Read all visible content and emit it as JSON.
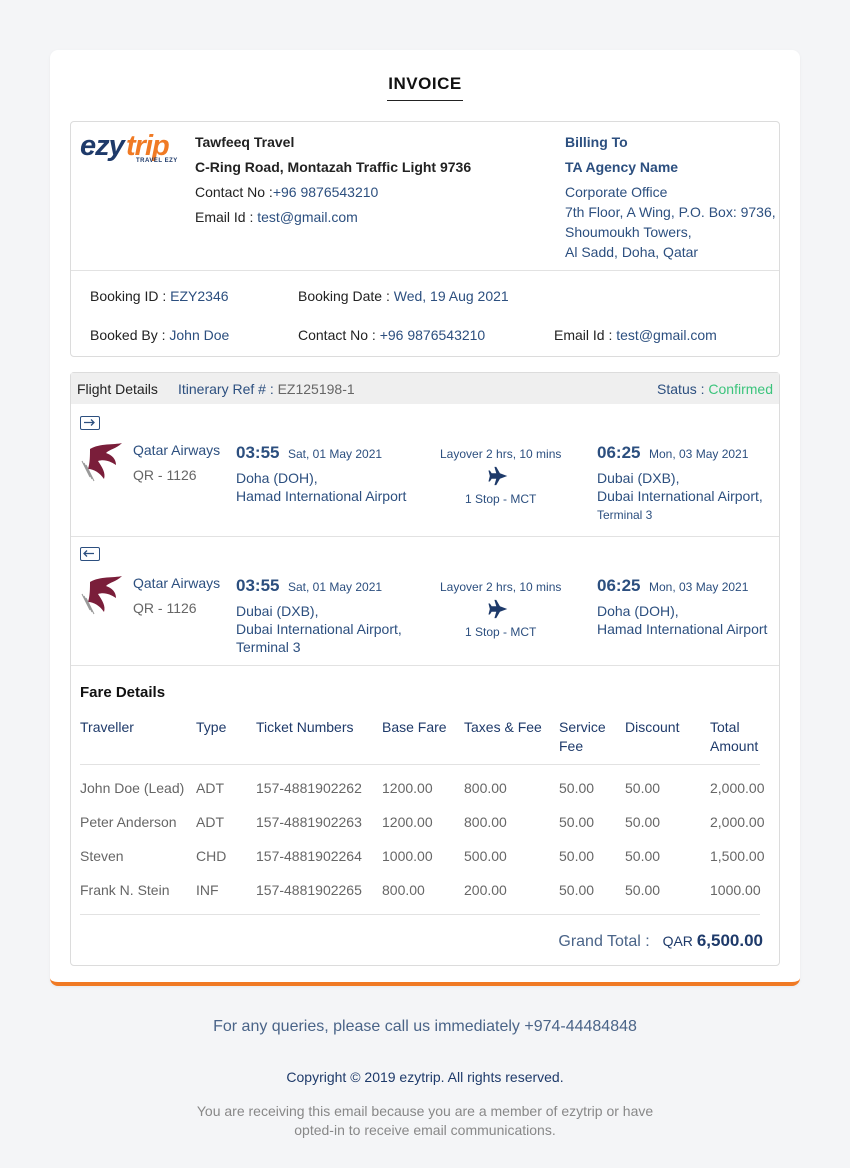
{
  "invoice_title": "INVOICE",
  "brand": {
    "logo_left": "ezy",
    "logo_right": "trip",
    "logo_tag": "TRAVEL EZY"
  },
  "company": {
    "name": "Tawfeeq Travel",
    "address": "C-Ring Road, Montazah Traffic Light 9736",
    "contact_label": "Contact No :",
    "contact_value": "+96 9876543210",
    "email_label": "Email Id :",
    "email_value": "test@gmail.com"
  },
  "billing": {
    "heading": "Billing To",
    "agency": "TA Agency Name",
    "line1": "Corporate Office",
    "line2": "7th Floor, A Wing, P.O. Box: 9736,",
    "line3": "Shoumoukh Towers,",
    "line4": "Al Sadd, Doha, Qatar"
  },
  "booking": {
    "id_label": "Booking ID :",
    "id_value": "EZY2346",
    "date_label": "Booking Date :",
    "date_value": "Wed, 19 Aug 2021",
    "by_label": "Booked By :",
    "by_value": "John Doe",
    "contact_label": "Contact No :",
    "contact_value": "+96 9876543210",
    "email_label": "Email Id :",
    "email_value": "test@gmail.com"
  },
  "flight_details": {
    "heading": "Flight Details",
    "itinerary_label": "Itinerary Ref # :",
    "itinerary_value": "EZ125198-1",
    "status_label": "Status :",
    "status_value": "Confirmed",
    "status_color": "#3cc47c",
    "segments": [
      {
        "airline": "Qatar Airways",
        "flight_no": "QR - 1126",
        "dep_time": "03:55",
        "dep_date": "Sat, 01 May 2021",
        "dep_city": "Doha (DOH),",
        "dep_airport": "Hamad International Airport",
        "dep_terminal": "",
        "layover": "Layover 2 hrs, 10 mins",
        "stops": "1 Stop - MCT",
        "arr_time": "06:25",
        "arr_date": "Mon, 03 May 2021",
        "arr_city": "Dubai (DXB),",
        "arr_airport": "Dubai International Airport,",
        "arr_terminal": "Terminal 3",
        "direction_icon": "departure-icon"
      },
      {
        "airline": "Qatar Airways",
        "flight_no": "QR - 1126",
        "dep_time": "03:55",
        "dep_date": "Sat, 01 May 2021",
        "dep_city": "Dubai (DXB),",
        "dep_airport": "Dubai International Airport,",
        "dep_terminal": "Terminal 3",
        "layover": "Layover 2 hrs, 10 mins",
        "stops": "1 Stop - MCT",
        "arr_time": "06:25",
        "arr_date": "Mon, 03 May 2021",
        "arr_city": "Doha (DOH),",
        "arr_airport": "Hamad International Airport",
        "arr_terminal": "",
        "direction_icon": "return-icon"
      }
    ]
  },
  "fare": {
    "heading": "Fare Details",
    "columns": [
      "Traveller",
      "Type",
      "Ticket Numbers",
      "Base Fare",
      "Taxes & Fee",
      "Service Fee",
      "Discount",
      "Total Amount"
    ],
    "rows": [
      [
        "John Doe (Lead)",
        "ADT",
        "157-4881902262",
        "1200.00",
        "800.00",
        "50.00",
        "50.00",
        "2,000.00"
      ],
      [
        "Peter Anderson",
        "ADT",
        "157-4881902263",
        "1200.00",
        "800.00",
        "50.00",
        "50.00",
        "2,000.00"
      ],
      [
        "Steven",
        "CHD",
        "157-4881902264",
        "1000.00",
        "500.00",
        "50.00",
        "50.00",
        "1,500.00"
      ],
      [
        "Frank N. Stein",
        "INF",
        "157-4881902265",
        "800.00",
        "200.00",
        "50.00",
        "50.00",
        "1000.00"
      ]
    ],
    "grand_total_label": "Grand Total :",
    "currency": "QAR",
    "grand_total_value": "6,500.00"
  },
  "footer": {
    "queries": "For any queries, please call us immediately +974-44484848",
    "copyright": "Copyright © 2019 ezytrip. All rights reserved.",
    "notice": "You are receiving this email because you are a member of ezytrip or have opted-in to receive email communications."
  },
  "colors": {
    "accent": "#f07a24",
    "navy": "#1e3a6a",
    "link_blue": "#2c4f7f",
    "confirmed": "#3cc47c"
  }
}
